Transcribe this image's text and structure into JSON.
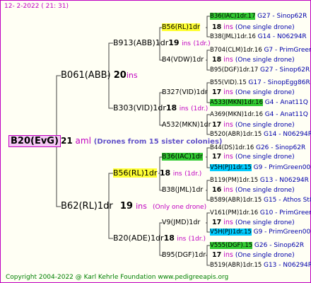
{
  "stamp": "12-  2-2022 (  21: 31)",
  "footer": "Copyright 2004-2022 @ Karl Kehrle Foundation    www.pedigreeapis.org",
  "root": {
    "name": "B20(EvG)",
    "num": "21",
    "ins": "aml",
    "note": "(Drones from 15 sister colonies)"
  },
  "gen1": [
    {
      "name": "B061(ABB)",
      "num": "20",
      "ins": "ins",
      "note": ""
    },
    {
      "name": "B62(RL)1dr",
      "num": "19",
      "ins": "ins",
      "note": "(Only one drone)"
    }
  ],
  "gen2": [
    {
      "name": "B913(ABB)1dr",
      "num": "19",
      "ins": "ins",
      "note": "(1dr.)"
    },
    {
      "name": "B303(VID)1dr",
      "num": "18",
      "ins": "ins",
      "note": "(1dr.)"
    },
    {
      "name": "B56(RL)1dr",
      "num": "18",
      "ins": "ins",
      "note": "(1dr.)"
    },
    {
      "name": "B20(ADE)1dr",
      "num": "18",
      "ins": "ins",
      "note": "(1dr.)"
    }
  ],
  "gen3": [
    {
      "name": "B56(RL)1dr",
      "num": "18",
      "ins": "ins",
      "note": "(One single drone)"
    },
    {
      "name": "B4(VDW)1dr",
      "num": "18",
      "ins": "ins",
      "note": "(One single drone)"
    },
    {
      "name": "B327(VID)1dr",
      "num": "17",
      "ins": "ins",
      "note": "(One single drone)"
    },
    {
      "name": "A532(MKN)1dr",
      "num": "17",
      "ins": "ins",
      "note": "(One single drone)"
    },
    {
      "name": "B36(IAC)1dr",
      "num": "17",
      "ins": "ins",
      "note": "(One single drone)"
    },
    {
      "name": "B38(JML)1dr",
      "num": "16",
      "ins": "ins",
      "note": "(One single drone)"
    },
    {
      "name": "V9(JMD)1dr",
      "num": "17",
      "ins": "ins",
      "note": "(One single drone)"
    },
    {
      "name": "B95(DGF)1dr",
      "num": "17",
      "ins": "ins",
      "note": "(One single drone)"
    }
  ],
  "gen4": [
    {
      "name": "B36(IAC)1dr.17",
      "loc": "G27 - Sinop62R"
    },
    {
      "name": "B38(JML)1dr.16",
      "loc": "G14 - N06294R"
    },
    {
      "name": "B704(CLM)1dr.16",
      "loc": "G7 - PrimGreen00"
    },
    {
      "name": "B95(DGF)1dr.17",
      "loc": "G27 - Sinop62R"
    },
    {
      "name": "B55(VID).15",
      "loc": "G17 - SinopEgg86R"
    },
    {
      "name": "A533(MKN)1dr.16",
      "loc": "G4 - Anat11Q"
    },
    {
      "name": "A369(MKN)1dr.16",
      "loc": "G4 - Anat11Q"
    },
    {
      "name": "B520(ABR)1dr.15",
      "loc": "G14 - N06294R"
    },
    {
      "name": "B44(DS)1dr.16",
      "loc": "G26 - Sinop62R"
    },
    {
      "name": "V5H(PJ)1dr.15",
      "loc": "G9 - PrimGreen00"
    },
    {
      "name": "B119(PM)1dr.15",
      "loc": "G13 - N06294R"
    },
    {
      "name": "B589(ABR)1dr.15",
      "loc": "G15 - Athos St80R"
    },
    {
      "name": "V161(PM)1dr.16",
      "loc": "G10 - PrimGreen00"
    },
    {
      "name": "V5H(PJ)1dr.15",
      "loc": "G9 - PrimGreen00"
    },
    {
      "name": "V555(DGF).15",
      "loc": "G26 - Sinop62R"
    },
    {
      "name": "B519(ABR)1dr.15",
      "loc": "G13 - N06294R"
    }
  ]
}
